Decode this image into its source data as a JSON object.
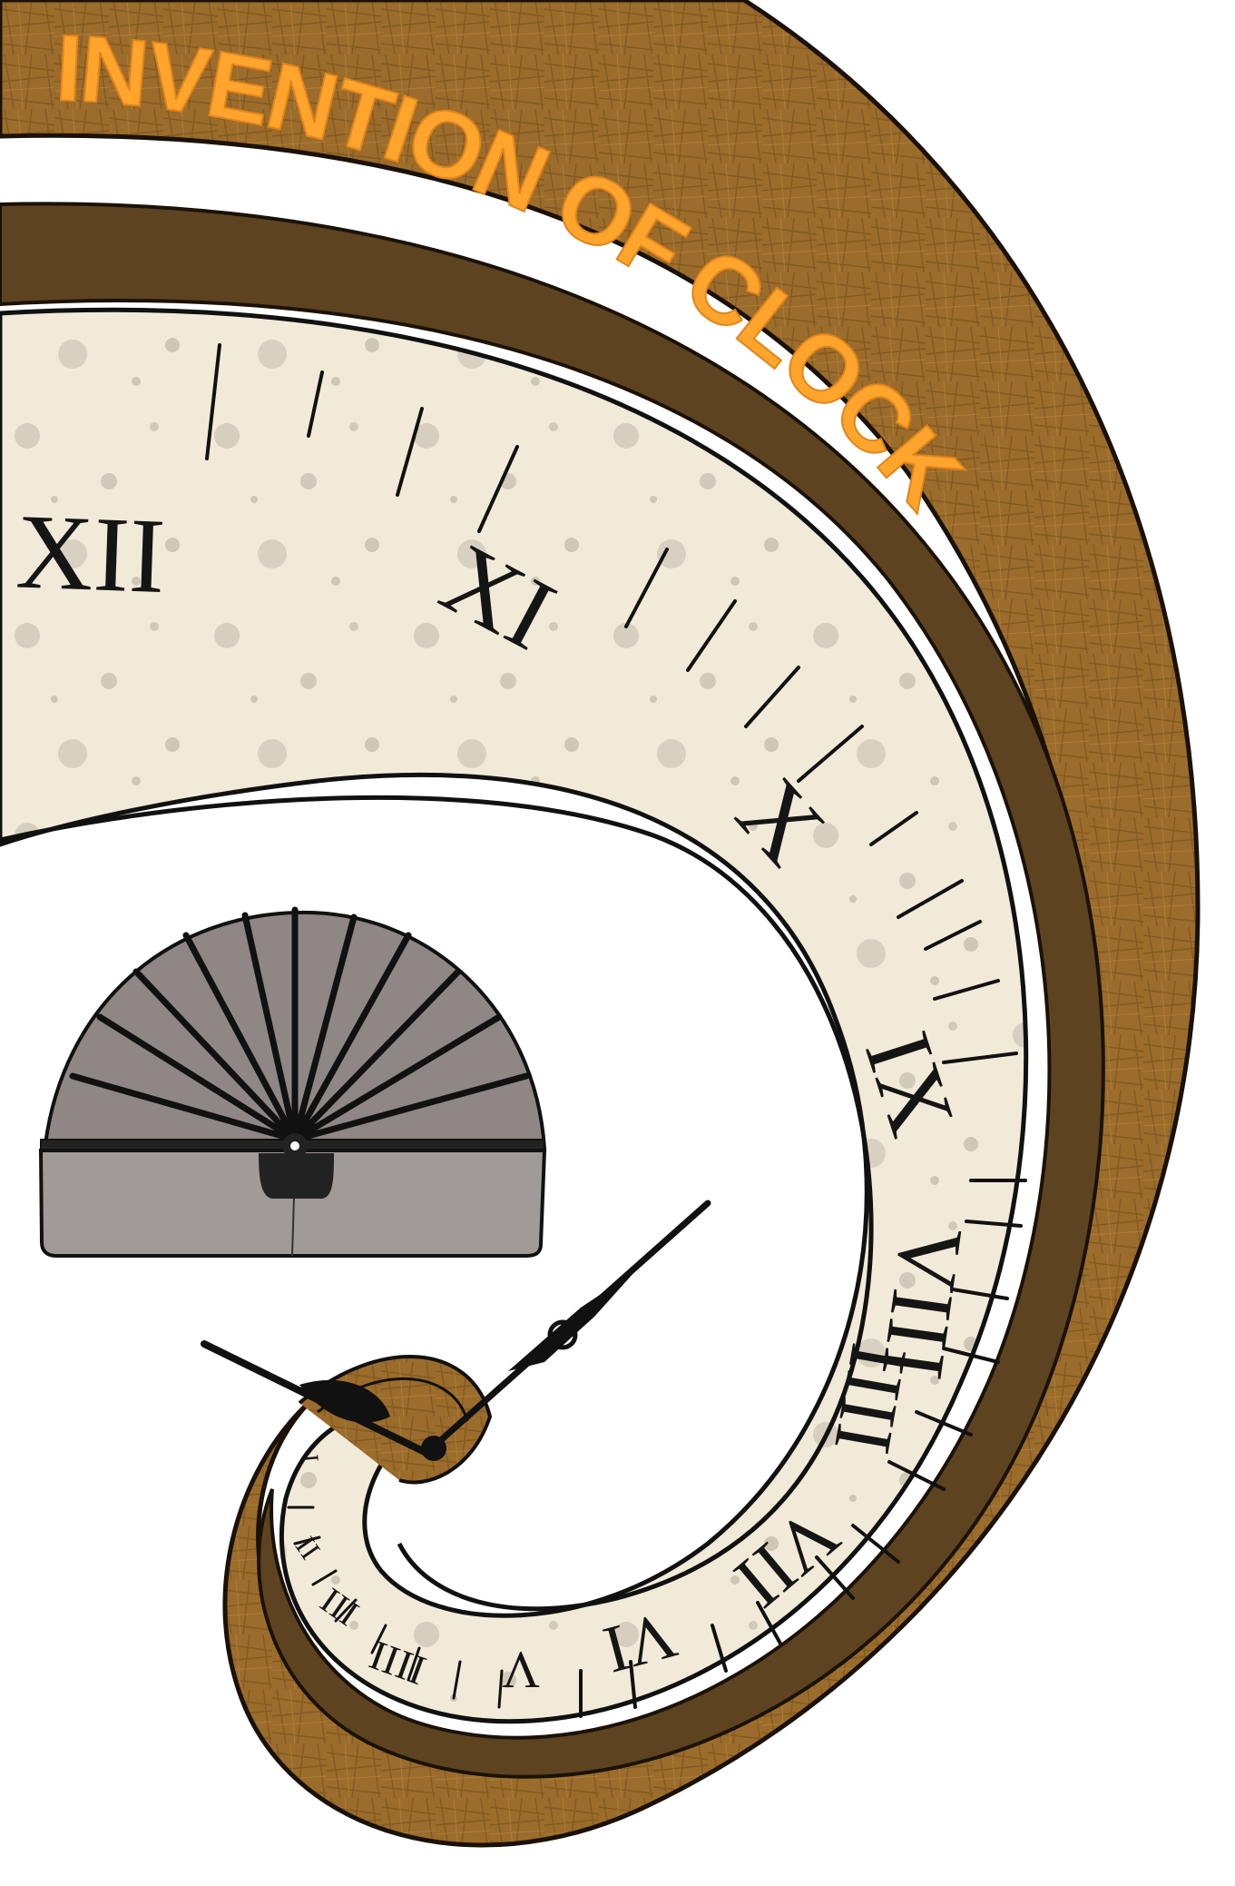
{
  "title": "INVENTION OF CLOCK",
  "numerals": {
    "xii": "XII",
    "xi": "XI",
    "x": "X",
    "ix": "IX",
    "viii": "VIII",
    "iiii": "IIII",
    "vii": "VII",
    "vi": "VI",
    "v": "V",
    "iiii_small": "IIII",
    "iii": "III",
    "ii": "II",
    "i": "I"
  },
  "colors": {
    "band_brown": "#9a6a2a",
    "band_dark": "#5e4320",
    "dial": "#f2ead8",
    "title": "#ffa52e",
    "sundial": "#8f8785"
  },
  "icons": [
    "spiral-clock-icon",
    "sundial-icon",
    "clock-hand-icon"
  ]
}
